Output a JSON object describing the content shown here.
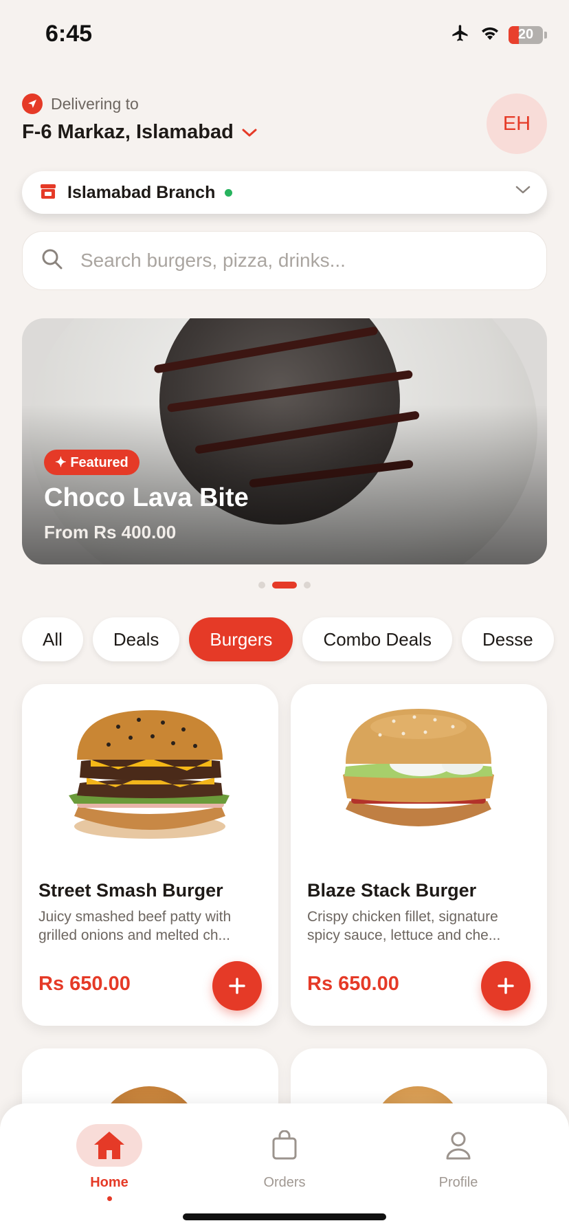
{
  "status_bar": {
    "time": "6:45",
    "battery": "20"
  },
  "location": {
    "label": "Delivering to",
    "address": "F-6 Markaz, Islamabad"
  },
  "avatar": {
    "initials": "EH"
  },
  "branch": {
    "name": "Islamabad Branch",
    "status_color": "#27b35e"
  },
  "search": {
    "placeholder": "Search burgers, pizza, drinks..."
  },
  "featured": {
    "badge": "✦ Featured",
    "title": "Choco Lava Bite",
    "price": "From Rs 400.00"
  },
  "carousel": {
    "count": 3,
    "active": 2
  },
  "categories": [
    {
      "label": "All",
      "active": false
    },
    {
      "label": "Deals",
      "active": false
    },
    {
      "label": "Burgers",
      "active": true
    },
    {
      "label": "Combo Deals",
      "active": false
    },
    {
      "label": "Desse",
      "active": false
    }
  ],
  "products": [
    {
      "name": "Street Smash Burger",
      "description": "Juicy smashed beef patty with grilled onions and melted ch...",
      "price": "Rs 650.00"
    },
    {
      "name": "Blaze Stack Burger",
      "description": "Crispy chicken fillet, signature spicy sauce, lettuce and che...",
      "price": "Rs 650.00"
    }
  ],
  "bottom_nav": [
    {
      "label": "Home",
      "icon": "home-icon",
      "active": true
    },
    {
      "label": "Orders",
      "icon": "bag-icon",
      "active": false
    },
    {
      "label": "Profile",
      "icon": "person-icon",
      "active": false
    }
  ],
  "colors": {
    "accent": "#e53a27",
    "background": "#f6f2ef"
  }
}
